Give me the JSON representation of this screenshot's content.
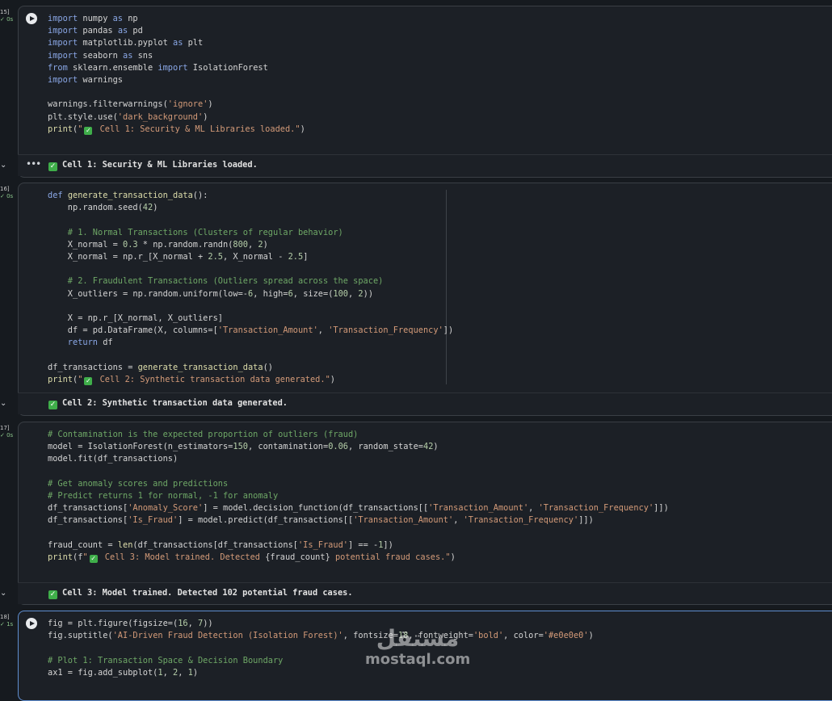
{
  "cells": [
    {
      "exec_count": "15]",
      "exec_time": "0s",
      "lines": [
        [
          [
            "kw",
            "import"
          ],
          [
            "bl",
            " numpy "
          ],
          [
            "kw",
            "as"
          ],
          [
            "bl",
            " np"
          ]
        ],
        [
          [
            "kw",
            "import"
          ],
          [
            "bl",
            " pandas "
          ],
          [
            "kw",
            "as"
          ],
          [
            "bl",
            " pd"
          ]
        ],
        [
          [
            "kw",
            "import"
          ],
          [
            "bl",
            " matplotlib.pyplot "
          ],
          [
            "kw",
            "as"
          ],
          [
            "bl",
            " plt"
          ]
        ],
        [
          [
            "kw",
            "import"
          ],
          [
            "bl",
            " seaborn "
          ],
          [
            "kw",
            "as"
          ],
          [
            "bl",
            " sns"
          ]
        ],
        [
          [
            "kw",
            "from"
          ],
          [
            "bl",
            " sklearn.ensemble "
          ],
          [
            "kw",
            "import"
          ],
          [
            "bl",
            " IsolationForest"
          ]
        ],
        [
          [
            "kw",
            "import"
          ],
          [
            "bl",
            " warnings"
          ]
        ],
        [],
        [
          [
            "bl",
            "warnings.filterwarnings("
          ],
          [
            "st",
            "'ignore'"
          ],
          [
            "bl",
            ")"
          ]
        ],
        [
          [
            "bl",
            "plt.style.use("
          ],
          [
            "st",
            "'dark_background'"
          ],
          [
            "bl",
            ")"
          ]
        ],
        [
          [
            "fn",
            "print"
          ],
          [
            "bl",
            "("
          ],
          [
            "st",
            "\""
          ],
          [
            "check",
            ""
          ],
          [
            "st",
            " Cell 1: Security & ML Libraries loaded.\""
          ],
          [
            "bl",
            ")"
          ]
        ]
      ],
      "output": "Cell 1: Security & ML Libraries loaded."
    },
    {
      "exec_count": "16]",
      "exec_time": "0s",
      "lines": [
        [
          [
            "kw",
            "def"
          ],
          [
            "bl",
            " "
          ],
          [
            "fn",
            "generate_transaction_data"
          ],
          [
            "bl",
            "():"
          ]
        ],
        [
          [
            "bl",
            "    np.random.seed("
          ],
          [
            "nm",
            "42"
          ],
          [
            "bl",
            ")"
          ]
        ],
        [],
        [
          [
            "cm",
            "    # 1. Normal Transactions (Clusters of regular behavior)"
          ]
        ],
        [
          [
            "bl",
            "    X_normal = "
          ],
          [
            "nm",
            "0.3"
          ],
          [
            "bl",
            " * np.random.randn("
          ],
          [
            "nm",
            "800"
          ],
          [
            "bl",
            ", "
          ],
          [
            "nm",
            "2"
          ],
          [
            "bl",
            ")"
          ]
        ],
        [
          [
            "bl",
            "    X_normal = np.r_[X_normal + "
          ],
          [
            "nm",
            "2.5"
          ],
          [
            "bl",
            ", X_normal - "
          ],
          [
            "nm",
            "2.5"
          ],
          [
            "bl",
            "]"
          ]
        ],
        [],
        [
          [
            "cm",
            "    # 2. Fraudulent Transactions (Outliers spread across the space)"
          ]
        ],
        [
          [
            "bl",
            "    X_outliers = np.random.uniform(low=-"
          ],
          [
            "nm",
            "6"
          ],
          [
            "bl",
            ", high="
          ],
          [
            "nm",
            "6"
          ],
          [
            "bl",
            ", size=("
          ],
          [
            "nm",
            "100"
          ],
          [
            "bl",
            ", "
          ],
          [
            "nm",
            "2"
          ],
          [
            "bl",
            "))"
          ]
        ],
        [],
        [
          [
            "bl",
            "    X = np.r_[X_normal, X_outliers]"
          ]
        ],
        [
          [
            "bl",
            "    df = pd.DataFrame(X, columns=["
          ],
          [
            "st",
            "'Transaction_Amount'"
          ],
          [
            "bl",
            ", "
          ],
          [
            "st",
            "'Transaction_Frequency'"
          ],
          [
            "bl",
            "])"
          ]
        ],
        [
          [
            "kw",
            "    return"
          ],
          [
            "bl",
            " df"
          ]
        ],
        [],
        [
          [
            "bl",
            "df_transactions = "
          ],
          [
            "fn",
            "generate_transaction_data"
          ],
          [
            "bl",
            "()"
          ]
        ],
        [
          [
            "fn",
            "print"
          ],
          [
            "bl",
            "("
          ],
          [
            "st",
            "\""
          ],
          [
            "check",
            ""
          ],
          [
            "st",
            " Cell 2: Synthetic transaction data generated.\""
          ],
          [
            "bl",
            ")"
          ]
        ]
      ],
      "output": "Cell 2: Synthetic transaction data generated."
    },
    {
      "exec_count": "17]",
      "exec_time": "0s",
      "lines": [
        [
          [
            "cm",
            "# Contamination is the expected proportion of outliers (fraud)"
          ]
        ],
        [
          [
            "bl",
            "model = IsolationForest(n_estimators="
          ],
          [
            "nm",
            "150"
          ],
          [
            "bl",
            ", contamination="
          ],
          [
            "nm",
            "0.06"
          ],
          [
            "bl",
            ", random_state="
          ],
          [
            "nm",
            "42"
          ],
          [
            "bl",
            ")"
          ]
        ],
        [
          [
            "bl",
            "model.fit(df_transactions)"
          ]
        ],
        [],
        [
          [
            "cm",
            "# Get anomaly scores and predictions"
          ]
        ],
        [
          [
            "cm",
            "# Predict returns 1 for normal, -1 for anomaly"
          ]
        ],
        [
          [
            "bl",
            "df_transactions["
          ],
          [
            "st",
            "'Anomaly_Score'"
          ],
          [
            "bl",
            "] = model.decision_function(df_transactions[["
          ],
          [
            "st",
            "'Transaction_Amount'"
          ],
          [
            "bl",
            ", "
          ],
          [
            "st",
            "'Transaction_Frequency'"
          ],
          [
            "bl",
            "]])"
          ]
        ],
        [
          [
            "bl",
            "df_transactions["
          ],
          [
            "st",
            "'Is_Fraud'"
          ],
          [
            "bl",
            "] = model.predict(df_transactions[["
          ],
          [
            "st",
            "'Transaction_Amount'"
          ],
          [
            "bl",
            ", "
          ],
          [
            "st",
            "'Transaction_Frequency'"
          ],
          [
            "bl",
            "]])"
          ]
        ],
        [],
        [
          [
            "bl",
            "fraud_count = "
          ],
          [
            "fn",
            "len"
          ],
          [
            "bl",
            "(df_transactions[df_transactions["
          ],
          [
            "st",
            "'Is_Fraud'"
          ],
          [
            "bl",
            "] == -"
          ],
          [
            "nm",
            "1"
          ],
          [
            "bl",
            "])"
          ]
        ],
        [
          [
            "fn",
            "print"
          ],
          [
            "bl",
            "(f"
          ],
          [
            "st",
            "\""
          ],
          [
            "check",
            ""
          ],
          [
            "st",
            " Cell 3: Model trained. Detected "
          ],
          [
            "bl",
            "{fraud_count}"
          ],
          [
            "st",
            " potential fraud cases.\""
          ],
          [
            "bl",
            ")"
          ]
        ]
      ],
      "output": "Cell 3: Model trained. Detected 102 potential fraud cases."
    },
    {
      "exec_count": "18]",
      "exec_time": "1s",
      "lines": [
        [
          [
            "bl",
            "fig = plt.figure(figsize=("
          ],
          [
            "nm",
            "16"
          ],
          [
            "bl",
            ", "
          ],
          [
            "nm",
            "7"
          ],
          [
            "bl",
            "))"
          ]
        ],
        [
          [
            "bl",
            "fig.suptitle("
          ],
          [
            "st",
            "'AI-Driven Fraud Detection (Isolation Forest)'"
          ],
          [
            "bl",
            ", fontsize="
          ],
          [
            "nm",
            "18"
          ],
          [
            "bl",
            ", fontweight="
          ],
          [
            "st",
            "'bold'"
          ],
          [
            "bl",
            ", color="
          ],
          [
            "st",
            "'#e0e0e0'"
          ],
          [
            "bl",
            ")"
          ]
        ],
        [],
        [
          [
            "cm",
            "# Plot 1: Transaction Space & Decision Boundary"
          ]
        ],
        [
          [
            "bl",
            "ax1 = fig.add_subplot("
          ],
          [
            "nm",
            "1"
          ],
          [
            "bl",
            ", "
          ],
          [
            "nm",
            "2"
          ],
          [
            "bl",
            ", "
          ],
          [
            "nm",
            "1"
          ],
          [
            "bl",
            ")"
          ]
        ]
      ]
    }
  ],
  "watermark": {
    "arabic": "مستقل",
    "latin": "mostaql.com"
  },
  "colors": {
    "keyword": "#8aa7e6",
    "string": "#d39a78",
    "comment": "#6ea766",
    "number": "#b5cea8",
    "function": "#dcdcaa",
    "check": "#3fae4a",
    "active_border": "#5f8ed0"
  }
}
